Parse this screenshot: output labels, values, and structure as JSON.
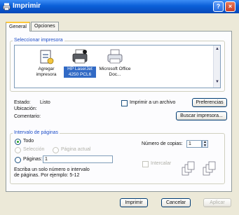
{
  "window": {
    "title": "Imprimir",
    "help_glyph": "?",
    "close_glyph": "×"
  },
  "tabs": [
    {
      "label": "General"
    },
    {
      "label": "Opciones"
    }
  ],
  "printer_group": {
    "label": "Seleccionar impresora"
  },
  "printers": [
    {
      "label": "Agregar impresora",
      "icon": "add-printer-icon"
    },
    {
      "label": "HP LaserJet 4250 PCL6",
      "icon": "laser-printer-icon",
      "selected": true
    },
    {
      "label": "Microsoft Office Doc...",
      "icon": "document-printer-icon"
    }
  ],
  "status": {
    "estado_label": "Estado:",
    "estado_value": "Listo",
    "ubicacion_label": "Ubicación:",
    "comentario_label": "Comentario:"
  },
  "print_to_file_label": "Imprimir a un archivo",
  "preferences_button": "Preferencias",
  "find_printer_button": "Buscar impresora...",
  "range_group": {
    "label": "Intervalo de páginas",
    "all_label": "Todo",
    "selection_label": "Selección",
    "current_page_label": "Página actual",
    "pages_label": "Páginas:",
    "pages_value": "1",
    "hint": "Escriba un solo número o intervalo de páginas. Por ejemplo: 5-12"
  },
  "copies": {
    "label": "Número de copias:",
    "value": "1",
    "collate_label": "Intercalar"
  },
  "buttons": {
    "print": "Imprimir",
    "cancel": "Cancelar",
    "apply": "Aplicar"
  },
  "colors": {
    "titlebar": "#0a5fd8",
    "selection": "#316ac5",
    "group_label": "#1f4fc8"
  }
}
